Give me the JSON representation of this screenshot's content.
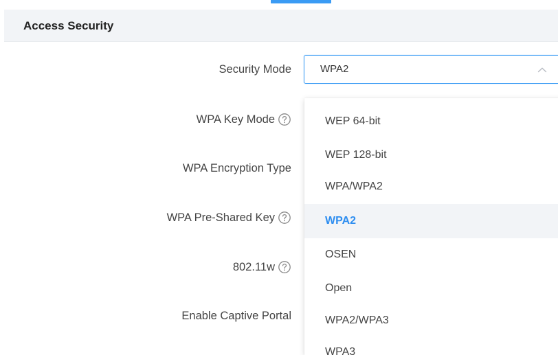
{
  "section": {
    "title": "Access Security"
  },
  "form": {
    "security_mode_label": "Security Mode",
    "wpa_key_mode_label": "WPA Key Mode",
    "wpa_encryption_type_label": "WPA Encryption Type",
    "wpa_psk_label": "WPA Pre-Shared Key",
    "dot11w_label": "802.11w",
    "captive_portal_label": "Enable Captive Portal"
  },
  "select": {
    "value": "WPA2"
  },
  "dropdown": {
    "options": [
      "WEP 64-bit",
      "WEP 128-bit",
      "WPA/WPA2",
      "WPA2",
      "OSEN",
      "Open",
      "WPA2/WPA3",
      "WPA3"
    ],
    "selected": "WPA2"
  },
  "icons": {
    "help": "help-circle-icon",
    "chevron": "chevron-up-icon"
  },
  "colors": {
    "accent": "#3a9bf4",
    "selected_text": "#2f8ef0",
    "header_bg": "#f2f4f7"
  }
}
